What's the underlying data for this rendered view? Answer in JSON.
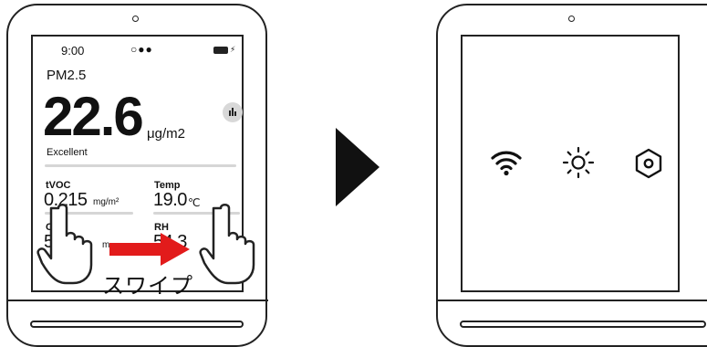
{
  "status_bar": {
    "time": "9:00",
    "dots": "○●●"
  },
  "pm": {
    "label": "PM2.5",
    "value": "22.6",
    "unit": "μg/m2",
    "status": "Excellent"
  },
  "metrics": {
    "tvoc": {
      "label": "tVOC",
      "value": "0.215",
      "unit": "mg/m²"
    },
    "temp": {
      "label": "Temp",
      "value": "19.0",
      "unit": "℃"
    },
    "co2": {
      "label": "CO2",
      "value": "5",
      "unit": "m"
    },
    "rh": {
      "label": "RH",
      "value": "54.3"
    }
  },
  "annotation": {
    "swipe_text": "スワイプ"
  },
  "settings_icons": [
    "wifi-icon",
    "brightness-icon",
    "settings-hex-icon"
  ],
  "colors": {
    "arrow_red": "#e21b1b",
    "outline": "#222222",
    "divider": "#d6d6d6"
  }
}
